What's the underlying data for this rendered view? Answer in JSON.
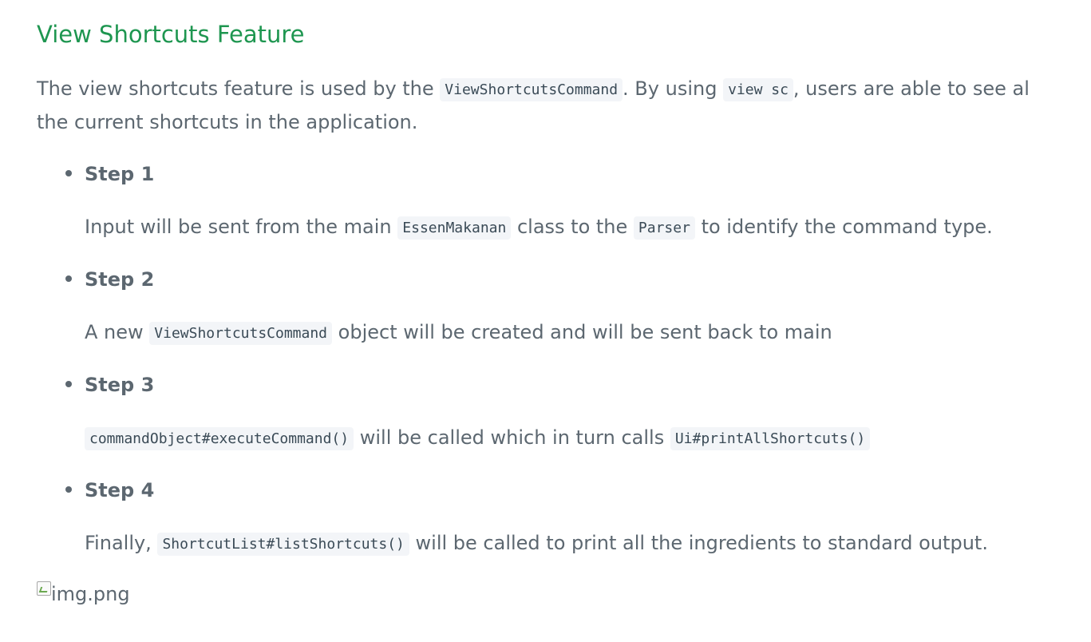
{
  "heading": "View Shortcuts Feature",
  "intro": {
    "text_1": "The view shortcuts feature is used by the ",
    "code_1": "ViewShortcutsCommand",
    "text_2": ". By using ",
    "code_2": "view sc",
    "text_3": ", users are able to see al the current shortcuts in the application."
  },
  "steps": [
    {
      "title": "Step 1",
      "parts": [
        "Input will be sent from the main ",
        "EssenMakanan",
        " class to the ",
        "Parser",
        " to identify the command type."
      ]
    },
    {
      "title": "Step 2",
      "parts": [
        "A new ",
        "ViewShortcutsCommand",
        " object will be created and will be sent back to main"
      ]
    },
    {
      "title": "Step 3",
      "parts": [
        "commandObject#executeCommand()",
        " will be called which in turn calls ",
        "Ui#printAllShortcuts()"
      ]
    },
    {
      "title": "Step 4",
      "parts": [
        "Finally, ",
        "ShortcutList#listShortcuts()",
        " will be called to print all the ingredients to standard output."
      ]
    }
  ],
  "image": {
    "alt": "img.png",
    "icon": "broken-image-icon"
  }
}
